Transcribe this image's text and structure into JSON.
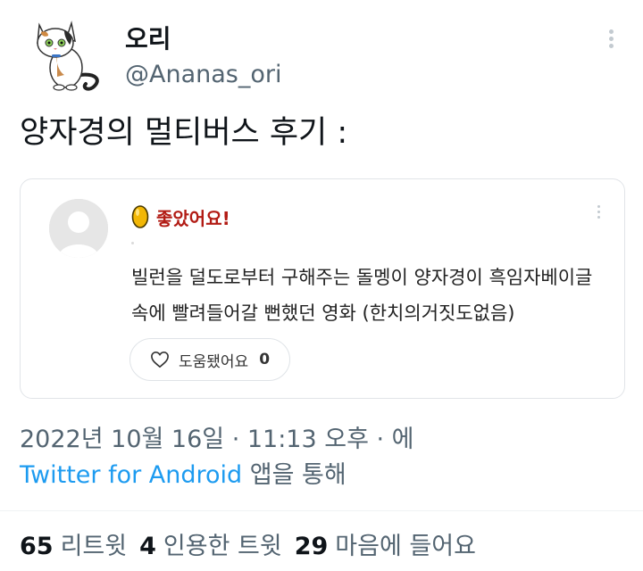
{
  "tweet": {
    "display_name": "오리",
    "handle": "@Ananas_ori",
    "text": "양자경의 멀티버스 후기 :",
    "meta": "2022년 10월 16일 · 11:13 오후 · 에",
    "source_app": "Twitter for Android",
    "source_suffix": " 앱을 통해"
  },
  "card": {
    "rating_label": "좋았어요!",
    "review_text": "빌런을 덜도로부터 구해주는 돌멩이 양자경이 흑임자베이글 속에 빨려들어갈 뻔했던 영화 (한치의거짓도없음)",
    "helpful_label": "도움됐어요",
    "helpful_count": "0"
  },
  "stats": {
    "retweets_count": "65",
    "retweets_label": "리트윗",
    "quotes_count": "4",
    "quotes_label": "인용한 트윗",
    "likes_count": "29",
    "likes_label": "마음에 들어요"
  },
  "icons": {
    "avatar": "cat-avatar-icon",
    "more": "more-vertical-icon",
    "egg": "golden-egg-icon",
    "heart": "heart-outline-icon"
  },
  "colors": {
    "link": "#1d9bf0",
    "rating": "#b21b14",
    "muted": "#536471"
  }
}
